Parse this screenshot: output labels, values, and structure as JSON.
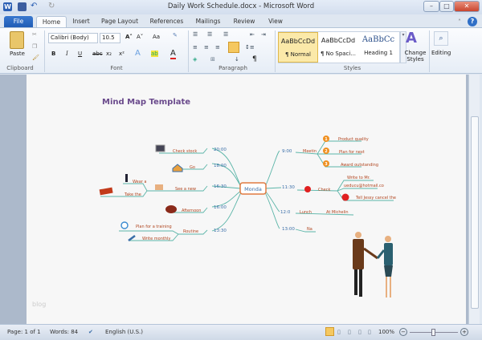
{
  "window": {
    "title": "Daily Work Schedule.docx - Microsoft Word",
    "minimize": "–",
    "maximize": "□",
    "close": "✕"
  },
  "tabs": [
    "File",
    "Home",
    "Insert",
    "Page Layout",
    "References",
    "Mailings",
    "Review",
    "View"
  ],
  "ribbon": {
    "clipboard": {
      "paste": "Paste",
      "label": "Clipboard"
    },
    "font": {
      "name": "Calibri (Body)",
      "size": "10.5",
      "bold": "B",
      "italic": "I",
      "underline": "U",
      "strike": "abc",
      "sub": "x₂",
      "sup": "x²",
      "grow": "A˄",
      "shrink": "A˅",
      "case": "Aa",
      "label": "Font"
    },
    "paragraph": {
      "label": "Paragraph",
      "pilcrow": "¶"
    },
    "styles": {
      "items": [
        {
          "preview": "AaBbCcDd",
          "name": "¶ Normal"
        },
        {
          "preview": "AaBbCcDd",
          "name": "¶ No Spaci..."
        },
        {
          "preview": "AaBbCc",
          "name": "Heading 1"
        }
      ],
      "change": "Change Styles",
      "label": "Styles"
    },
    "editing": "Editing"
  },
  "document": {
    "heading": "Mind Map Template",
    "watermark": "blog",
    "center": "Monda",
    "left": {
      "times": [
        "20:00",
        "18:00",
        "16:30",
        "16:00",
        "13:30"
      ],
      "nodes": {
        "check_stock": "Check stock",
        "go": "Go",
        "see_new": "See a new",
        "wear": "Wear a",
        "take": "Take the",
        "afternoon": "Afternoon",
        "routine": "Routine",
        "plan_training": "Plan for a training",
        "write_monthly": "Write monthly"
      }
    },
    "right": {
      "times": [
        "9:00",
        "11:30",
        "12:0",
        "13:00"
      ],
      "nodes": {
        "meeting": "Meetin",
        "product": "Product quality",
        "plan_next": "Plan for next",
        "award": "Award outstanding",
        "check": "Check",
        "write_mr": "Write to Mr.",
        "email": "ueducu@hotmail.co",
        "tell": "Tell Jessy cancel the",
        "lunch": "Lunch",
        "michelin": "At Michelin",
        "na": "Na"
      },
      "numbers": [
        "1",
        "2",
        "3"
      ]
    },
    "colors": {
      "branch": "#5bb5a8",
      "label": "#b0451f",
      "time": "#3a6ea8",
      "center_border": "#e07a40",
      "heading": "#6a4a8c"
    }
  },
  "status": {
    "page": "Page: 1 of 1",
    "words": "Words: 84",
    "language": "English (U.S.)",
    "zoom": "100%",
    "zoom_value": 100
  }
}
